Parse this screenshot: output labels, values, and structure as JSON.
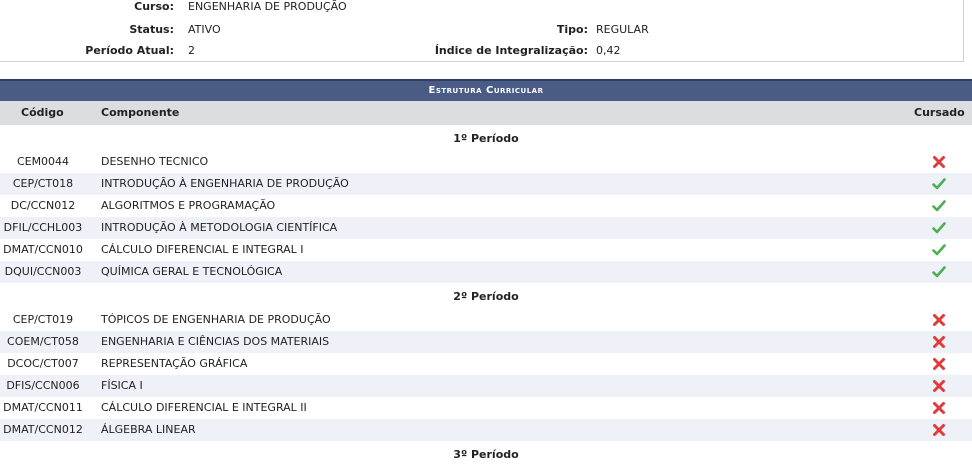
{
  "info": {
    "curso_label": "Curso:",
    "curso_value": "ENGENHARIA DE PRODUÇÃO",
    "status_label": "Status:",
    "status_value": "ATIVO",
    "tipo_label": "Tipo:",
    "tipo_value": "REGULAR",
    "periodo_label": "Período Atual:",
    "periodo_value": "2",
    "indice_label": "Índice de Integralização:",
    "indice_value": "0,42"
  },
  "table": {
    "caption": "Estrutura Curricular",
    "col_codigo": "Código",
    "col_componente": "Componente",
    "col_cursado": "Cursado",
    "periods": [
      {
        "label": "1º Período",
        "rows": [
          {
            "code": "CEM0044",
            "name": "DESENHO TECNICO",
            "done": false
          },
          {
            "code": "CEP/CT018",
            "name": "INTRODUÇÃO À ENGENHARIA DE PRODUÇÃO",
            "done": true
          },
          {
            "code": "DC/CCN012",
            "name": "ALGORITMOS E PROGRAMAÇÃO",
            "done": true
          },
          {
            "code": "DFIL/CCHL003",
            "name": "INTRODUÇÃO À METODOLOGIA CIENTÍFICA",
            "done": true
          },
          {
            "code": "DMAT/CCN010",
            "name": "CÁLCULO DIFERENCIAL E INTEGRAL I",
            "done": true
          },
          {
            "code": "DQUI/CCN003",
            "name": "QUÍMICA GERAL E TECNOLÓGICA",
            "done": true
          }
        ]
      },
      {
        "label": "2º Período",
        "rows": [
          {
            "code": "CEP/CT019",
            "name": "TÓPICOS DE ENGENHARIA DE PRODUÇÃO",
            "done": false
          },
          {
            "code": "COEM/CT058",
            "name": "ENGENHARIA E CIÊNCIAS DOS MATERIAIS",
            "done": false
          },
          {
            "code": "DCOC/CT007",
            "name": "REPRESENTAÇÃO GRÁFICA",
            "done": false
          },
          {
            "code": "DFIS/CCN006",
            "name": "FÍSICA I",
            "done": false
          },
          {
            "code": "DMAT/CCN011",
            "name": "CÁLCULO DIFERENCIAL E INTEGRAL II",
            "done": false
          },
          {
            "code": "DMAT/CCN012",
            "name": "ÁLGEBRA LINEAR",
            "done": false
          }
        ]
      },
      {
        "label": "3º Período",
        "rows": []
      }
    ]
  },
  "icons": {
    "done": "check-icon",
    "not_done": "cross-icon",
    "check_color": "#4caf50",
    "cross_color": "#e03b3b"
  }
}
